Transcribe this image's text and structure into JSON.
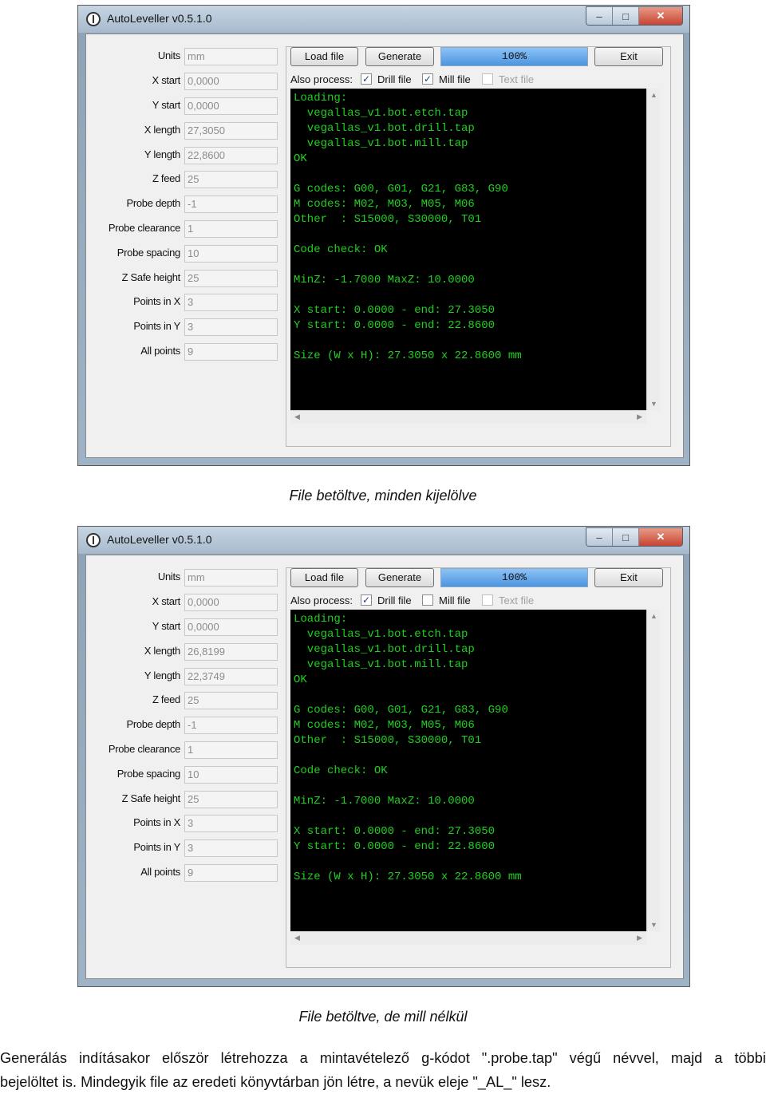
{
  "windows": [
    {
      "title": "AutoLeveller v0.5.1.0",
      "controls": [
        "–",
        "□",
        "✕"
      ],
      "fields": [
        {
          "label": "Units",
          "value": "mm"
        },
        {
          "label": "X start",
          "value": "0,0000"
        },
        {
          "label": "Y start",
          "value": "0,0000"
        },
        {
          "label": "X length",
          "value": "27,3050"
        },
        {
          "label": "Y length",
          "value": "22,8600"
        },
        {
          "label": "Z feed",
          "value": "25"
        },
        {
          "label": "Probe depth",
          "value": "-1"
        },
        {
          "label": "Probe clearance",
          "value": "1"
        },
        {
          "label": "Probe spacing",
          "value": "10"
        },
        {
          "label": "Z Safe height",
          "value": "25"
        },
        {
          "label": "Points in X",
          "value": "3"
        },
        {
          "label": "Points in Y",
          "value": "3"
        },
        {
          "label": "All points",
          "value": "9"
        }
      ],
      "buttons": {
        "load": "Load file",
        "generate": "Generate",
        "exit": "Exit"
      },
      "progress": "100%",
      "also_process": "Also process:",
      "checkboxes": [
        {
          "label": "Drill file",
          "checked": true,
          "enabled": true
        },
        {
          "label": "Mill file",
          "checked": true,
          "enabled": true
        },
        {
          "label": "Text file",
          "checked": false,
          "enabled": false
        }
      ],
      "console": "Loading:\n  vegallas_v1.bot.etch.tap\n  vegallas_v1.bot.drill.tap\n  vegallas_v1.bot.mill.tap\nOK\n\nG codes: G00, G01, G21, G83, G90\nM codes: M02, M03, M05, M06\nOther  : S15000, S30000, T01\n\nCode check: OK\n\nMinZ: -1.7000 MaxZ: 10.0000\n\nX start: 0.0000 - end: 27.3050\nY start: 0.0000 - end: 22.8600\n\nSize (W x H): 27.3050 x 22.8600 mm"
    },
    {
      "title": "AutoLeveller v0.5.1.0",
      "controls": [
        "–",
        "□",
        "✕"
      ],
      "fields": [
        {
          "label": "Units",
          "value": "mm"
        },
        {
          "label": "X start",
          "value": "0,0000"
        },
        {
          "label": "Y start",
          "value": "0,0000"
        },
        {
          "label": "X length",
          "value": "26,8199"
        },
        {
          "label": "Y length",
          "value": "22,3749"
        },
        {
          "label": "Z feed",
          "value": "25"
        },
        {
          "label": "Probe depth",
          "value": "-1"
        },
        {
          "label": "Probe clearance",
          "value": "1"
        },
        {
          "label": "Probe spacing",
          "value": "10"
        },
        {
          "label": "Z Safe height",
          "value": "25"
        },
        {
          "label": "Points in X",
          "value": "3"
        },
        {
          "label": "Points in Y",
          "value": "3"
        },
        {
          "label": "All points",
          "value": "9"
        }
      ],
      "buttons": {
        "load": "Load file",
        "generate": "Generate",
        "exit": "Exit"
      },
      "progress": "100%",
      "also_process": "Also process:",
      "checkboxes": [
        {
          "label": "Drill file",
          "checked": true,
          "enabled": true
        },
        {
          "label": "Mill file",
          "checked": false,
          "enabled": true
        },
        {
          "label": "Text file",
          "checked": false,
          "enabled": false
        }
      ],
      "console": "Loading:\n  vegallas_v1.bot.etch.tap\n  vegallas_v1.bot.drill.tap\n  vegallas_v1.bot.mill.tap\nOK\n\nG codes: G00, G01, G21, G83, G90\nM codes: M02, M03, M05, M06\nOther  : S15000, S30000, T01\n\nCode check: OK\n\nMinZ: -1.7000 MaxZ: 10.0000\n\nX start: 0.0000 - end: 27.3050\nY start: 0.0000 - end: 22.8600\n\nSize (W x H): 27.3050 x 22.8600 mm"
    }
  ],
  "captions": [
    "File betöltve, minden kijelölve",
    "File betöltve, de mill nélkül"
  ],
  "paragraph": {
    "line1": [
      "Generálás",
      "indításakor",
      "először",
      "létrehozza",
      "a",
      "mintavételező",
      "g-kódot",
      "\".probe.tap\"",
      "végű",
      "névvel,",
      "majd",
      "a",
      "többi"
    ],
    "line2": "bejelöltet is. Mindegyik file az eredeti könyvtárban jön létre, a nevük eleje \"_AL_\" lesz."
  }
}
